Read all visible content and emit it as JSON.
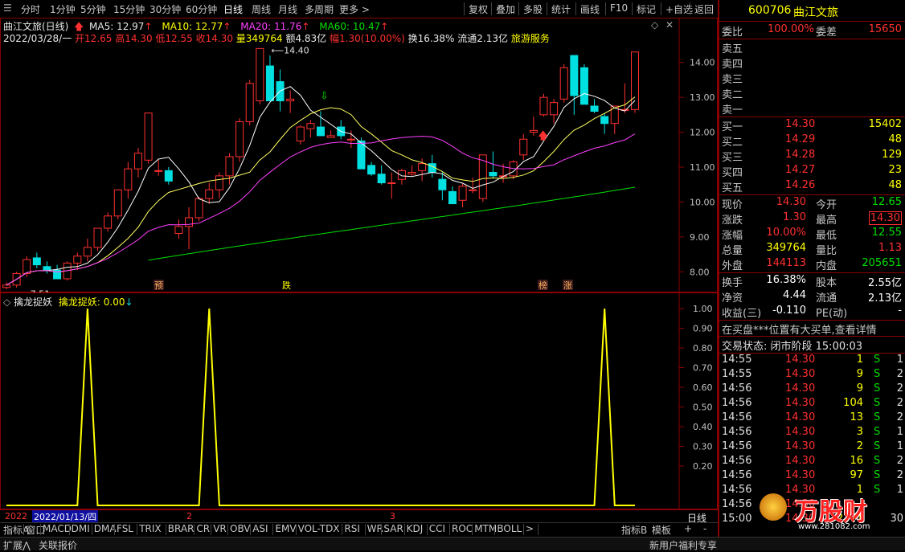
{
  "topbar": {
    "left_items": [
      "分时",
      "1分钟",
      "5分钟",
      "15分钟",
      "30分钟",
      "60分钟",
      "日线",
      "周线",
      "月线",
      "多周期",
      "更多 >"
    ],
    "active": "日线",
    "right_items": [
      "复权",
      "叠加",
      "多股",
      "统计",
      "画线",
      "F10",
      "标记",
      "+自选",
      "返回"
    ]
  },
  "chart_header": {
    "name": "曲江文旅(日线)",
    "ma5_label": "MA5: 12.97",
    "ma10_label": "MA10: 12.77",
    "ma20_label": "MA20: 11.76",
    "ma60_label": "MA60: 10.47",
    "date": "2022/03/28/一",
    "open": "开12.65",
    "high": "高14.30",
    "low": "低12.55",
    "close": "收14.30",
    "vol": "量349764",
    "amount": "额4.83亿",
    "amp": "幅1.30(10.00%)",
    "turnover": "换16.38%",
    "float": "流通2.13亿",
    "sector": "旅游服务"
  },
  "colors": {
    "up": "#ff3030",
    "down": "#00e0e0",
    "ma5": "#ffffff",
    "ma10": "#ffff60",
    "ma20": "#ff40ff",
    "ma60": "#00e000",
    "indicator": "#ffff00",
    "border": "#8a0000"
  },
  "chart_data": {
    "type": "candlestick",
    "ylim": [
      7.5,
      14.5
    ],
    "y_ticks": [
      "14.00",
      "13.00",
      "12.00",
      "11.00",
      "10.00",
      "9.00",
      "8.00"
    ],
    "candles": [
      [
        7.55,
        7.7,
        7.5,
        7.62
      ],
      [
        7.62,
        8.0,
        7.55,
        7.95
      ],
      [
        7.95,
        8.45,
        7.85,
        8.35
      ],
      [
        8.4,
        8.55,
        8.1,
        8.2
      ],
      [
        8.15,
        8.3,
        7.95,
        8.05
      ],
      [
        8.05,
        8.2,
        7.9,
        7.8
      ],
      [
        7.8,
        8.3,
        7.75,
        8.25
      ],
      [
        8.25,
        8.55,
        8.05,
        8.45
      ],
      [
        8.45,
        8.95,
        8.3,
        8.7
      ],
      [
        8.7,
        9.25,
        8.6,
        9.25
      ],
      [
        9.25,
        9.7,
        9.15,
        9.6
      ],
      [
        9.6,
        10.35,
        9.5,
        10.35
      ],
      [
        10.35,
        11.15,
        10.1,
        10.95
      ],
      [
        10.95,
        11.55,
        10.7,
        11.4
      ],
      [
        11.2,
        12.55,
        11.1,
        12.55
      ],
      [
        10.9,
        11.2,
        10.75,
        10.9
      ],
      [
        10.9,
        11.0,
        10.5,
        10.6
      ],
      [
        9.1,
        9.5,
        8.95,
        9.3
      ],
      [
        9.3,
        9.85,
        8.65,
        9.55
      ],
      [
        9.55,
        10.15,
        9.45,
        10.1
      ],
      [
        10.1,
        10.55,
        9.95,
        10.35
      ],
      [
        10.35,
        10.85,
        10.1,
        10.75
      ],
      [
        10.75,
        11.4,
        10.5,
        11.3
      ],
      [
        11.3,
        12.4,
        11.15,
        12.3
      ],
      [
        12.3,
        13.5,
        12.2,
        13.4
      ],
      [
        12.9,
        14.4,
        12.8,
        14.4
      ],
      [
        13.9,
        14.2,
        12.9,
        12.9
      ],
      [
        13.45,
        13.8,
        12.6,
        12.9
      ],
      [
        12.9,
        13.2,
        12.55,
        12.95
      ],
      [
        11.75,
        12.2,
        11.65,
        12.15
      ],
      [
        12.1,
        12.35,
        11.85,
        12.25
      ],
      [
        12.15,
        12.6,
        11.9,
        11.9
      ],
      [
        11.85,
        12.05,
        11.85,
        11.9
      ],
      [
        12.15,
        12.35,
        11.8,
        11.9
      ],
      [
        11.8,
        12.05,
        11.55,
        11.8
      ],
      [
        11.75,
        11.85,
        10.95,
        10.95
      ],
      [
        11.05,
        11.15,
        10.75,
        10.8
      ],
      [
        10.8,
        11.05,
        10.5,
        10.55
      ],
      [
        10.55,
        10.85,
        10.1,
        10.55
      ],
      [
        10.65,
        10.95,
        10.5,
        10.9
      ],
      [
        10.8,
        11.05,
        10.75,
        10.85
      ],
      [
        10.9,
        11.25,
        10.6,
        11.1
      ],
      [
        11.1,
        11.35,
        10.7,
        10.85
      ],
      [
        10.65,
        10.85,
        10.05,
        10.35
      ],
      [
        10.3,
        10.45,
        9.95,
        9.95
      ],
      [
        10.05,
        10.55,
        9.85,
        10.45
      ],
      [
        10.35,
        10.7,
        10.25,
        10.35
      ],
      [
        10.1,
        11.35,
        10.0,
        11.35
      ],
      [
        10.85,
        11.45,
        10.7,
        10.75
      ],
      [
        10.75,
        11.1,
        10.55,
        10.75
      ],
      [
        10.75,
        11.2,
        10.65,
        11.15
      ],
      [
        11.35,
        11.95,
        11.2,
        11.8
      ],
      [
        12.0,
        12.45,
        11.9,
        12.05
      ],
      [
        12.5,
        13.1,
        12.45,
        13.0
      ],
      [
        12.5,
        12.95,
        12.25,
        12.85
      ],
      [
        12.95,
        13.95,
        12.85,
        13.85
      ],
      [
        14.2,
        14.2,
        12.5,
        13.05
      ],
      [
        13.85,
        13.95,
        12.8,
        12.8
      ],
      [
        12.75,
        12.95,
        12.55,
        12.6
      ],
      [
        12.45,
        12.55,
        11.95,
        12.25
      ],
      [
        12.25,
        12.75,
        11.95,
        12.75
      ],
      [
        12.65,
        13.4,
        12.55,
        12.65
      ],
      [
        12.65,
        14.3,
        12.55,
        14.3
      ]
    ],
    "annotations": {
      "high": "14.40",
      "low": "7.51"
    },
    "markers": [
      "预",
      "跌",
      "榜",
      "涨"
    ],
    "indicator": {
      "name": "擒龙捉妖",
      "value_label": "擒龙捉妖: 0.00",
      "y_ticks": [
        "1.00",
        "0.90",
        "0.80",
        "0.70",
        "0.60",
        "0.50",
        "0.40",
        "0.30",
        "0.20"
      ],
      "peaks_at": [
        8,
        20,
        59
      ]
    },
    "x_labels": [
      "2022/01/13/四",
      "2",
      "3"
    ],
    "x_prefix": "2022",
    "period": "日线"
  },
  "bottom_tabs": [
    "指标A",
    "窗口",
    "MACD",
    "DMI",
    "DMA",
    "FSL",
    "TRIX",
    "BRAR",
    "CR",
    "VR",
    "OBV",
    "ASI",
    "EMV",
    "VOL-TDX",
    "RSI",
    "WR",
    "SAR",
    "KDJ",
    "CCI",
    "ROC",
    "MTM",
    "BOLL",
    ">"
  ],
  "bottom_right": [
    "指标B",
    "模板",
    "+",
    "-"
  ],
  "statusbar": {
    "left1": "扩展⋀",
    "left2": "关联报价",
    "right": "新用户福利专享"
  },
  "right_panel": {
    "code": "600706",
    "name": "曲江文旅",
    "weibi_label": "委比",
    "weibi": "100.00%",
    "weicha_label": "委差",
    "weicha": "15650",
    "sells": [
      "卖五",
      "卖四",
      "卖三",
      "卖二",
      "卖一"
    ],
    "buys": [
      {
        "label": "买一",
        "price": "14.30",
        "vol": "15402"
      },
      {
        "label": "买二",
        "price": "14.29",
        "vol": "48"
      },
      {
        "label": "买三",
        "price": "14.28",
        "vol": "129"
      },
      {
        "label": "买四",
        "price": "14.27",
        "vol": "23"
      },
      {
        "label": "买五",
        "price": "14.26",
        "vol": "48"
      }
    ],
    "stats": [
      {
        "l": "现价",
        "v": "14.30",
        "l2": "今开",
        "v2": "12.65"
      },
      {
        "l": "涨跌",
        "v": "1.30",
        "l2": "最高",
        "v2": "14.30"
      },
      {
        "l": "涨幅",
        "v": "10.00%",
        "l2": "最低",
        "v2": "12.55"
      },
      {
        "l": "总量",
        "v": "349764",
        "l2": "量比",
        "v2": "1.13"
      },
      {
        "l": "外盘",
        "v": "144113",
        "l2": "内盘",
        "v2": "205651"
      }
    ],
    "stats2": [
      {
        "l": "换手",
        "v": "16.38%",
        "l2": "股本",
        "v2": "2.55亿"
      },
      {
        "l": "净资",
        "v": "4.44",
        "l2": "流通",
        "v2": "2.13亿"
      },
      {
        "l": "收益(三)",
        "v": "-0.110",
        "l2": "PE(动)",
        "v2": "-"
      }
    ],
    "notice": "在买盘***位置有大买单,查看详情",
    "trade_status": "交易状态: 闭市阶段 15:00:03",
    "ticks": [
      {
        "t": "14:55",
        "p": "14.30",
        "v": "1",
        "s": "S",
        "n": "1"
      },
      {
        "t": "14:55",
        "p": "14.30",
        "v": "9",
        "s": "S",
        "n": "2"
      },
      {
        "t": "14:56",
        "p": "14.30",
        "v": "9",
        "s": "S",
        "n": "2"
      },
      {
        "t": "14:56",
        "p": "14.30",
        "v": "104",
        "s": "S",
        "n": "2"
      },
      {
        "t": "14:56",
        "p": "14.30",
        "v": "13",
        "s": "S",
        "n": "2"
      },
      {
        "t": "14:56",
        "p": "14.30",
        "v": "3",
        "s": "S",
        "n": "1"
      },
      {
        "t": "14:56",
        "p": "14.30",
        "v": "2",
        "s": "S",
        "n": "1"
      },
      {
        "t": "14:56",
        "p": "14.30",
        "v": "16",
        "s": "S",
        "n": "2"
      },
      {
        "t": "14:56",
        "p": "14.30",
        "v": "97",
        "s": "S",
        "n": "2"
      },
      {
        "t": "14:56",
        "p": "14.30",
        "v": "1",
        "s": "S",
        "n": "1"
      },
      {
        "t": "14:56",
        "p": "14.30",
        "v": "",
        "s": "",
        "n": ""
      },
      {
        "t": "15:00",
        "p": "14.30",
        "v": "2771",
        "s": "",
        "n": "30"
      }
    ],
    "watermark": "万股财",
    "watermark_url": "www.281082.com"
  }
}
